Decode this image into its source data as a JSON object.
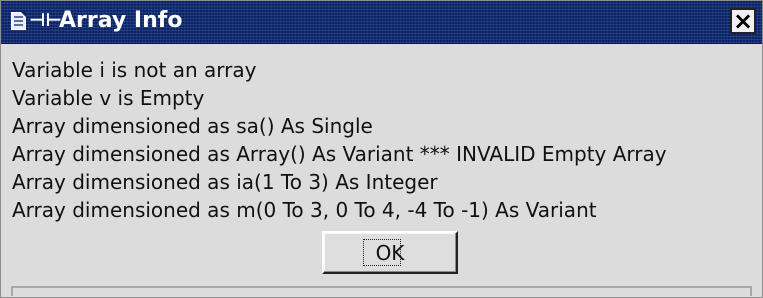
{
  "window": {
    "title": "Array Info",
    "icons": {
      "app": "document-icon",
      "pin": "pin-icon",
      "close": "close-icon"
    },
    "colors": {
      "titlebar": "#0a246a",
      "dialog_background": "#dcdcdc",
      "text": "#111111"
    }
  },
  "messages": [
    "Variable i is not an array",
    "Variable v is Empty",
    "Array dimensioned as sa() As Single",
    "Array dimensioned as Array() As Variant *** INVALID Empty Array",
    "Array dimensioned as ia(1 To 3) As Integer",
    "Array dimensioned as m(0 To 3, 0 To 4, -4 To -1) As Variant"
  ],
  "buttons": {
    "close_label": "×",
    "ok_label": "OK",
    "pin_glyph": "⊣⊢"
  }
}
